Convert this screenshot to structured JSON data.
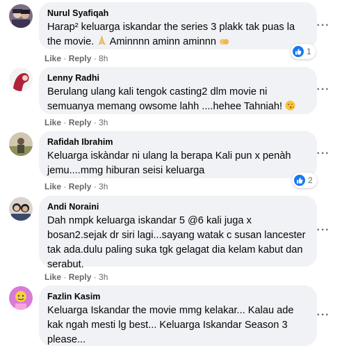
{
  "comments": [
    {
      "author": "Nurul Syafiqah",
      "text_line1": "Harap² keluarga iskandar the series 3 plakk tak puas la",
      "text_line2_a": "the movie.",
      "text_line2_b": "Aminnnn aminn aminnn",
      "like_label": "Like",
      "reply_label": "Reply",
      "time": "8h",
      "reaction_count": "1",
      "reaction_icon": "like-icon"
    },
    {
      "author": "Lenny Radhi",
      "text_line1": "Berulang ulang kali tengok casting2 dlm movie ni",
      "text_line2": "semuanya memang owsome lahh ....hehee Tahniah!",
      "like_label": "Like",
      "reply_label": "Reply",
      "time": "3h"
    },
    {
      "author": "Rafidah Ibrahim",
      "text_line1": "Keluarga iskàndar ni ulang la berapa Kali pun x penàh",
      "text_line2": "jemu....mmg hiburan seisi keluarga",
      "like_label": "Like",
      "reply_label": "Reply",
      "time": "3h",
      "reaction_count": "2",
      "reaction_icon": "like-icon"
    },
    {
      "author": "Andi Noraini",
      "text_line1": "Dah nmpk keluarga iskandar 5 @6 kali juga x",
      "text_line2": "bosan2.sejak dr siri lagi...sayang watak c susan lancester",
      "text_line3": "tak ada.dulu paling suka tgk gelagat dia kelam kabut dan",
      "text_line4": "serabut.",
      "like_label": "Like",
      "reply_label": "Reply",
      "time": "3h"
    },
    {
      "author": "Fazlin Kasim",
      "text_line1": "Keluarga Iskandar the movie mmg kelakar... Kalau ade",
      "text_line2": "kak ngah mesti lg best... Keluarga Iskandar Season 3",
      "text_line3": "please..."
    }
  ],
  "colors": {
    "bubble": "#f0f2f5",
    "meta_text": "#65676b",
    "like_blue": "#1877f2"
  }
}
